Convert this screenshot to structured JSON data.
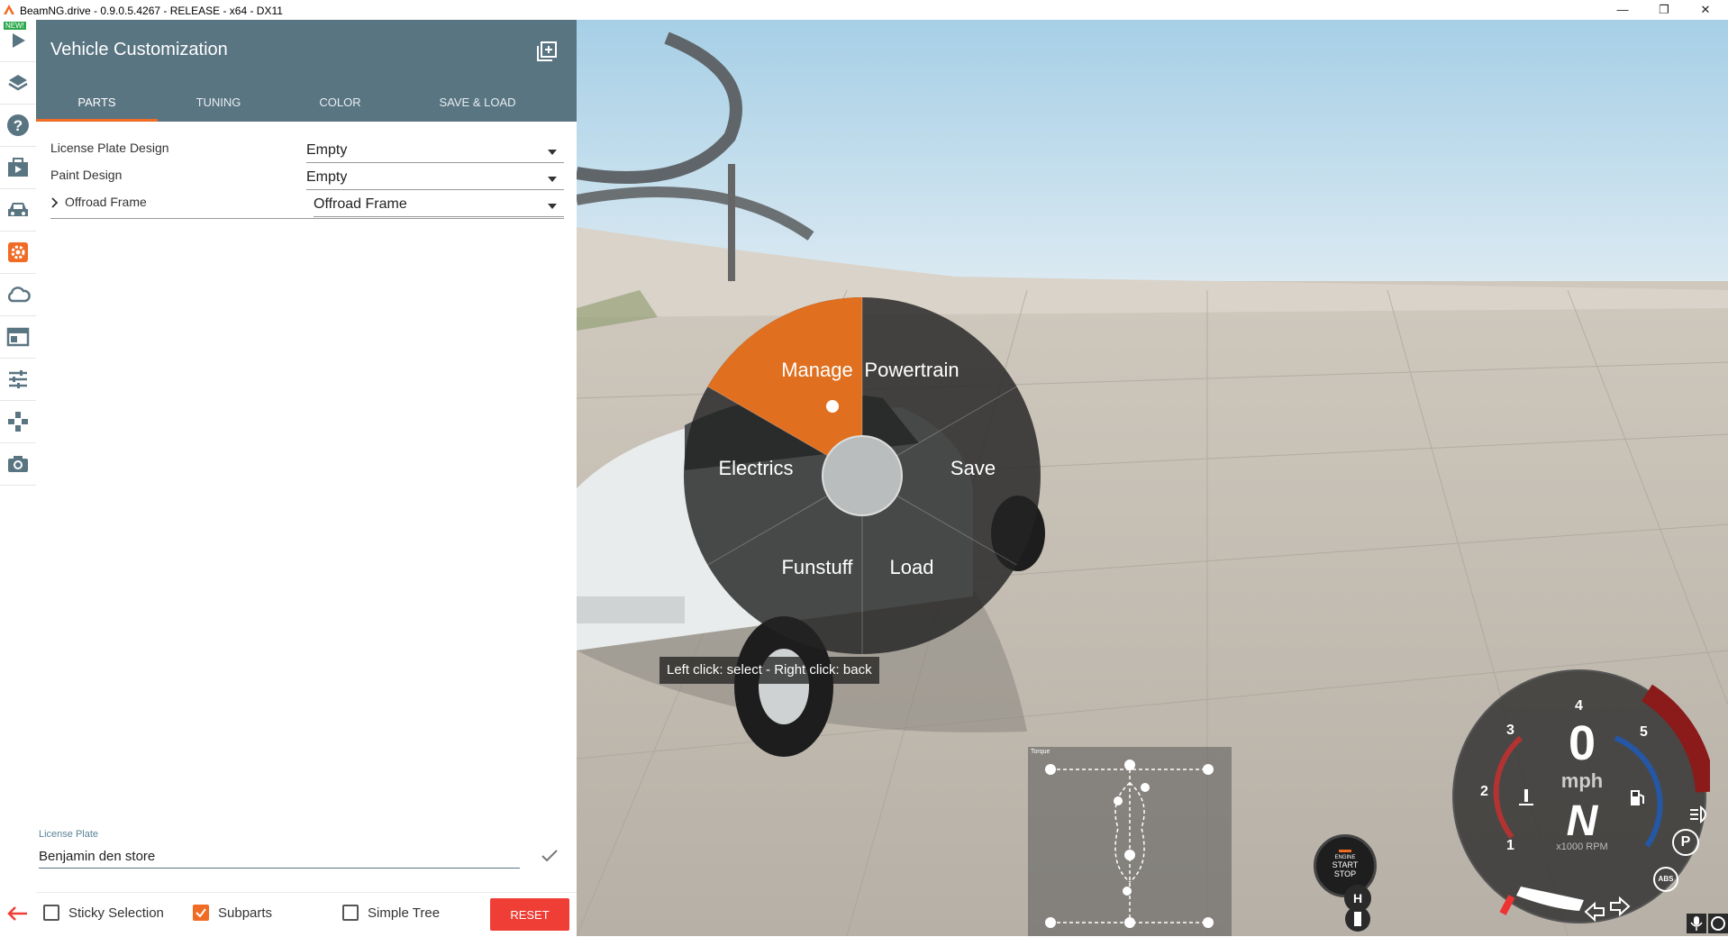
{
  "window": {
    "title": "BeamNG.drive - 0.9.0.5.4267 - RELEASE - x64 - DX11",
    "minimize": "—",
    "maximize": "❐",
    "close": "✕"
  },
  "sidebar": {
    "badge": "NEW!",
    "items": [
      "play-icon",
      "layers-icon",
      "help-icon",
      "scenario-icon",
      "vehicle-icon",
      "gear-icon",
      "cloud-icon",
      "app-layout-icon",
      "sliders-icon",
      "gamepad-icon",
      "camera-icon"
    ],
    "active_color": "#f06b24"
  },
  "panel": {
    "title": "Vehicle Customization",
    "tabs": [
      {
        "label": "PARTS",
        "active": true
      },
      {
        "label": "TUNING",
        "active": false
      },
      {
        "label": "COLOR",
        "active": false
      },
      {
        "label": "SAVE & LOAD",
        "active": false
      }
    ],
    "parts": [
      {
        "label": "License Plate Design",
        "value": "Empty"
      },
      {
        "label": "Paint Design",
        "value": "Empty"
      },
      {
        "label": "Offroad Frame",
        "value": "Offroad Frame",
        "expandable": true
      }
    ],
    "license_plate": {
      "label": "License Plate",
      "value": "Benjamin den store"
    },
    "footer": {
      "sticky_selection": {
        "label": "Sticky Selection",
        "checked": false
      },
      "subparts": {
        "label": "Subparts",
        "checked": true
      },
      "simple_tree": {
        "label": "Simple Tree",
        "checked": false
      },
      "reset": "RESET"
    },
    "header_color": "#5a7582",
    "accent": "#f06b24"
  },
  "radial_menu": {
    "items": [
      "Manage",
      "Powertrain",
      "Save",
      "Load",
      "Funstuff",
      "Electrics"
    ],
    "selected": "Manage",
    "hint": "Left click: select - Right click: back"
  },
  "hud": {
    "minimap_title": "Torque",
    "engine": {
      "line1": "ENGINE",
      "line2": "START",
      "line3": "STOP"
    },
    "speed": "0",
    "speed_unit": "mph",
    "gear": "N",
    "rpm_unit": "x1000 RPM",
    "rpm_ticks": [
      "1",
      "2",
      "3",
      "4",
      "5"
    ],
    "handbrake": "H",
    "parking": "P",
    "abs": "ABS"
  }
}
